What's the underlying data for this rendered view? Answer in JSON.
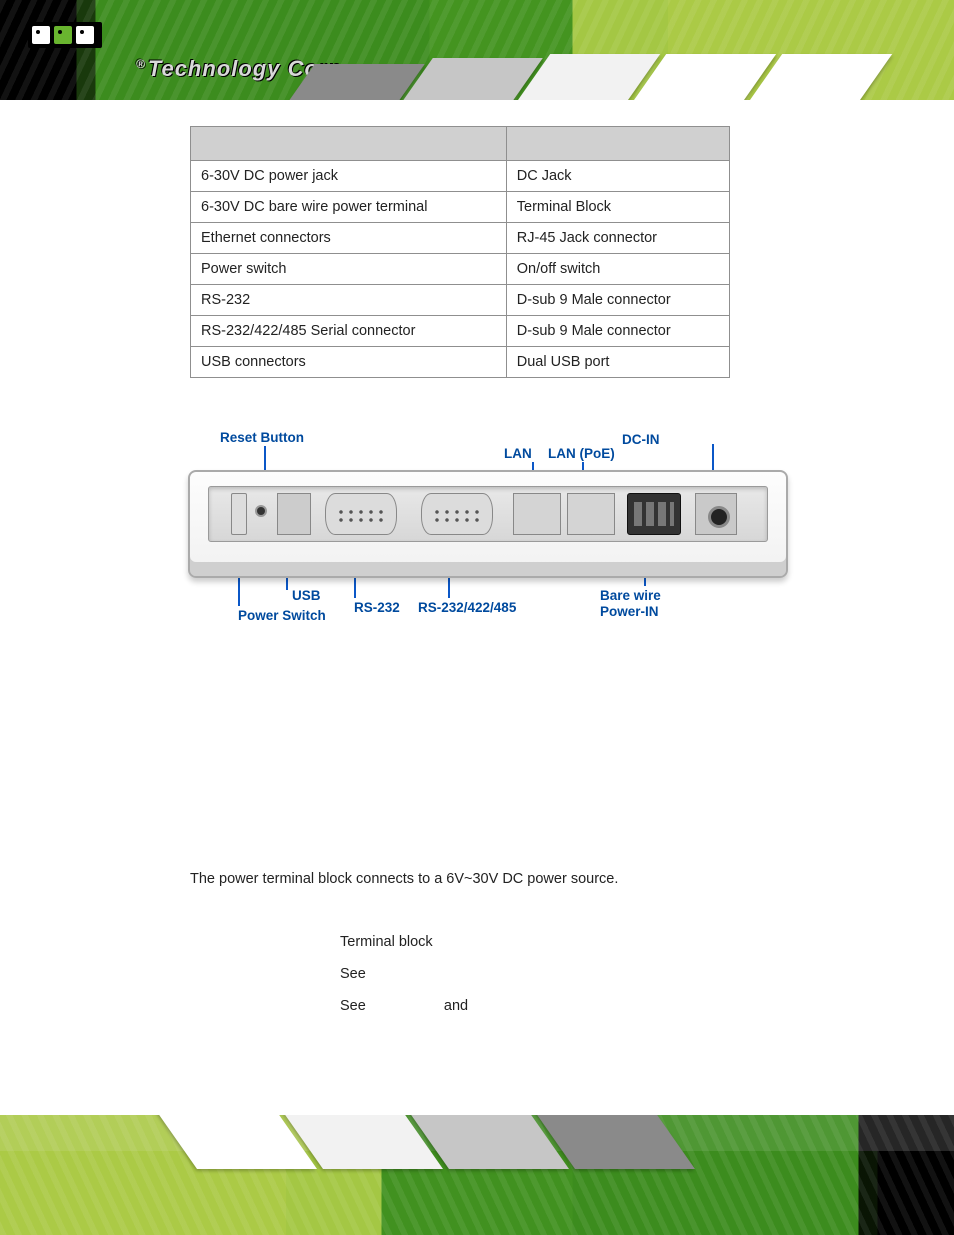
{
  "logo": {
    "brand": "Technology Corp.",
    "registered": "®"
  },
  "table": {
    "header_left": "",
    "header_right": "",
    "rows": [
      {
        "l": "6-30V DC power jack",
        "r": "DC Jack"
      },
      {
        "l": "6-30V DC bare wire power terminal",
        "r": "Terminal Block"
      },
      {
        "l": "Ethernet connectors",
        "r": "RJ-45 Jack connector"
      },
      {
        "l": "Power switch",
        "r": "On/off switch"
      },
      {
        "l": "RS-232",
        "r": "D-sub 9 Male connector"
      },
      {
        "l": "RS-232/422/485 Serial connector",
        "r": "D-sub 9 Male connector"
      },
      {
        "l": "USB connectors",
        "r": "Dual USB port"
      }
    ]
  },
  "diagram": {
    "reset": "Reset Button",
    "lan": "LAN",
    "lan_poe": "LAN (PoE)",
    "dc_in": "DC-IN",
    "usb": "USB",
    "power_switch": "Power Switch",
    "rs232": "RS-232",
    "rs232_422_485": "RS-232/422/485",
    "bare_wire_1": "Bare wire",
    "bare_wire_2": "Power-IN"
  },
  "description": "The power terminal block connects to a 6V~30V DC power source.",
  "spec": {
    "line1": "Terminal block",
    "line2": "See",
    "line3a": "See",
    "line3b": "and"
  }
}
